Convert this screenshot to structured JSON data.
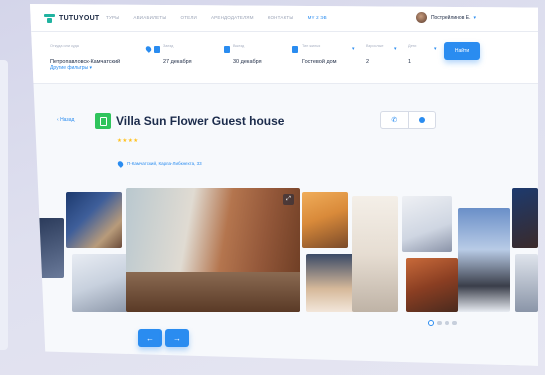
{
  "app": {
    "logo_text": "TUTUYOUT"
  },
  "nav": {
    "links": [
      "ТУРЫ",
      "АВИАБИЛЕТЫ",
      "ОТЕЛИ",
      "АРЕНДОДАТЕЛЯМ",
      "КОНТАКТЫ",
      "Мy 2 Эв"
    ],
    "user_name": "Пострейлинов Е."
  },
  "search": {
    "destination_label": "Откуда или куда",
    "destination": "Петропавловск-Камчатский",
    "checkin_label": "Заезд",
    "checkin": "27 декабря",
    "checkout_label": "Выезд",
    "checkout": "30 декабря",
    "type_label": "Тип жилья",
    "type": "Гостевой дом",
    "adults_label": "Взрослые",
    "adults": "2",
    "children_label": "Дети",
    "children": "1",
    "search_button": "Найти",
    "other_filters": "Другие фильтры"
  },
  "hotel": {
    "back_label": "Назад",
    "name": "Villa Sun Flower Guest house",
    "stars": "★★★★",
    "address": "П-Камчатский, Карла-Либкнехта, 33"
  },
  "icons": {
    "logo": "logo-mark",
    "phone": "phone-icon",
    "chat": "chat-icon",
    "pin": "pin-icon",
    "calendar": "calendar-icon",
    "expand": "expand-icon",
    "arrow_left": "arrow-left-icon",
    "arrow_right": "arrow-right-icon"
  },
  "colors": {
    "accent": "#2a8cf0",
    "star": "#ffc11e",
    "hotel_icon": "#2fc45c",
    "logo": "#21b3a0",
    "title": "#1c2c4c"
  },
  "gallery": {
    "active_slide": 1,
    "slide_count": 4
  }
}
